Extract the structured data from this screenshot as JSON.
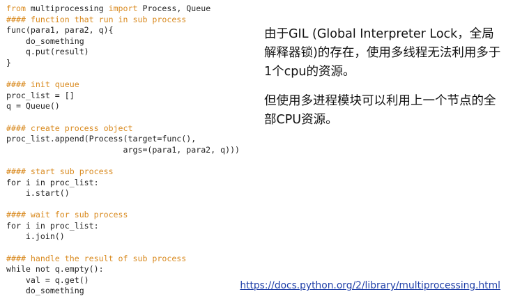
{
  "code": {
    "lines": [
      {
        "segments": [
          {
            "type": "kw",
            "text": "from"
          },
          {
            "type": "plain",
            "text": " multiprocessing "
          },
          {
            "type": "kw",
            "text": "import"
          },
          {
            "type": "plain",
            "text": " Process, Queue"
          }
        ]
      },
      {
        "segments": [
          {
            "type": "comment",
            "text": "#### function that run in sub process"
          }
        ]
      },
      {
        "segments": [
          {
            "type": "plain",
            "text": "func(para1, para2, q){"
          }
        ]
      },
      {
        "segments": [
          {
            "type": "plain",
            "text": "    do_something"
          }
        ]
      },
      {
        "segments": [
          {
            "type": "plain",
            "text": "    q.put(result)"
          }
        ]
      },
      {
        "segments": [
          {
            "type": "plain",
            "text": "}"
          }
        ]
      },
      {
        "segments": []
      },
      {
        "segments": [
          {
            "type": "comment",
            "text": "#### init queue"
          }
        ]
      },
      {
        "segments": [
          {
            "type": "plain",
            "text": "proc_list = []"
          }
        ]
      },
      {
        "segments": [
          {
            "type": "plain",
            "text": "q = Queue()"
          }
        ]
      },
      {
        "segments": []
      },
      {
        "segments": [
          {
            "type": "comment",
            "text": "#### create process object"
          }
        ]
      },
      {
        "segments": [
          {
            "type": "plain",
            "text": "proc_list.append(Process(target=func(),"
          }
        ]
      },
      {
        "segments": [
          {
            "type": "plain",
            "text": "                        args=(para1, para2, q)))"
          }
        ]
      },
      {
        "segments": []
      },
      {
        "segments": [
          {
            "type": "comment",
            "text": "#### start sub process"
          }
        ]
      },
      {
        "segments": [
          {
            "type": "plain",
            "text": "for i in proc_list:"
          }
        ]
      },
      {
        "segments": [
          {
            "type": "plain",
            "text": "    i.start()"
          }
        ]
      },
      {
        "segments": []
      },
      {
        "segments": [
          {
            "type": "comment",
            "text": "#### wait for sub process"
          }
        ]
      },
      {
        "segments": [
          {
            "type": "plain",
            "text": "for i in proc_list:"
          }
        ]
      },
      {
        "segments": [
          {
            "type": "plain",
            "text": "    i.join()"
          }
        ]
      },
      {
        "segments": []
      },
      {
        "segments": [
          {
            "type": "comment",
            "text": "#### handle the result of sub process"
          }
        ]
      },
      {
        "segments": [
          {
            "type": "plain",
            "text": "while not q.empty():"
          }
        ]
      },
      {
        "segments": [
          {
            "type": "plain",
            "text": "    val = q.get()"
          }
        ]
      },
      {
        "segments": [
          {
            "type": "plain",
            "text": "    do_something"
          }
        ]
      }
    ]
  },
  "explanation": {
    "paragraph_1": "由于GIL (Global Interpreter Lock，全局解释器锁)的存在，使用多线程无法利用多于1个cpu的资源。",
    "paragraph_2": "但使用多进程模块可以利用上一个节点的全部CPU资源。"
  },
  "link": {
    "text": "https://docs.python.org/2/library/multiprocessing.html"
  },
  "colors": {
    "comment": "#d98a1f",
    "code_text": "#222222",
    "link": "#1f3fa8",
    "background": "#ffffff"
  }
}
